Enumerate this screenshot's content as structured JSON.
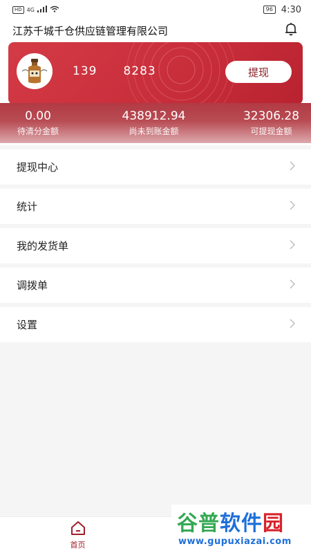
{
  "status_bar": {
    "network": "4G",
    "hd": "HD",
    "battery": "96",
    "time": "4:30"
  },
  "header": {
    "company": "江苏千城千仓供应链管理有限公司"
  },
  "card": {
    "phone": "139    8283",
    "withdraw_label": "提现",
    "stats": [
      {
        "value": "0.00",
        "label": "待清分金额"
      },
      {
        "value": "438912.94",
        "label": "尚未到账金额"
      },
      {
        "value": "32306.28",
        "label": "可提现金额"
      }
    ]
  },
  "menu": [
    {
      "label": "提现中心"
    },
    {
      "label": "统计"
    },
    {
      "label": "我的发货单"
    },
    {
      "label": "调拨单"
    },
    {
      "label": "设置"
    }
  ],
  "tabbar": {
    "home_label": "首页"
  },
  "watermark": {
    "title_chars": [
      "谷",
      "普",
      "软",
      "件",
      "园"
    ],
    "url": "www.gupuxiazai.com"
  },
  "colors": {
    "accent": "#c82d3a",
    "tab_active": "#a01f29"
  }
}
